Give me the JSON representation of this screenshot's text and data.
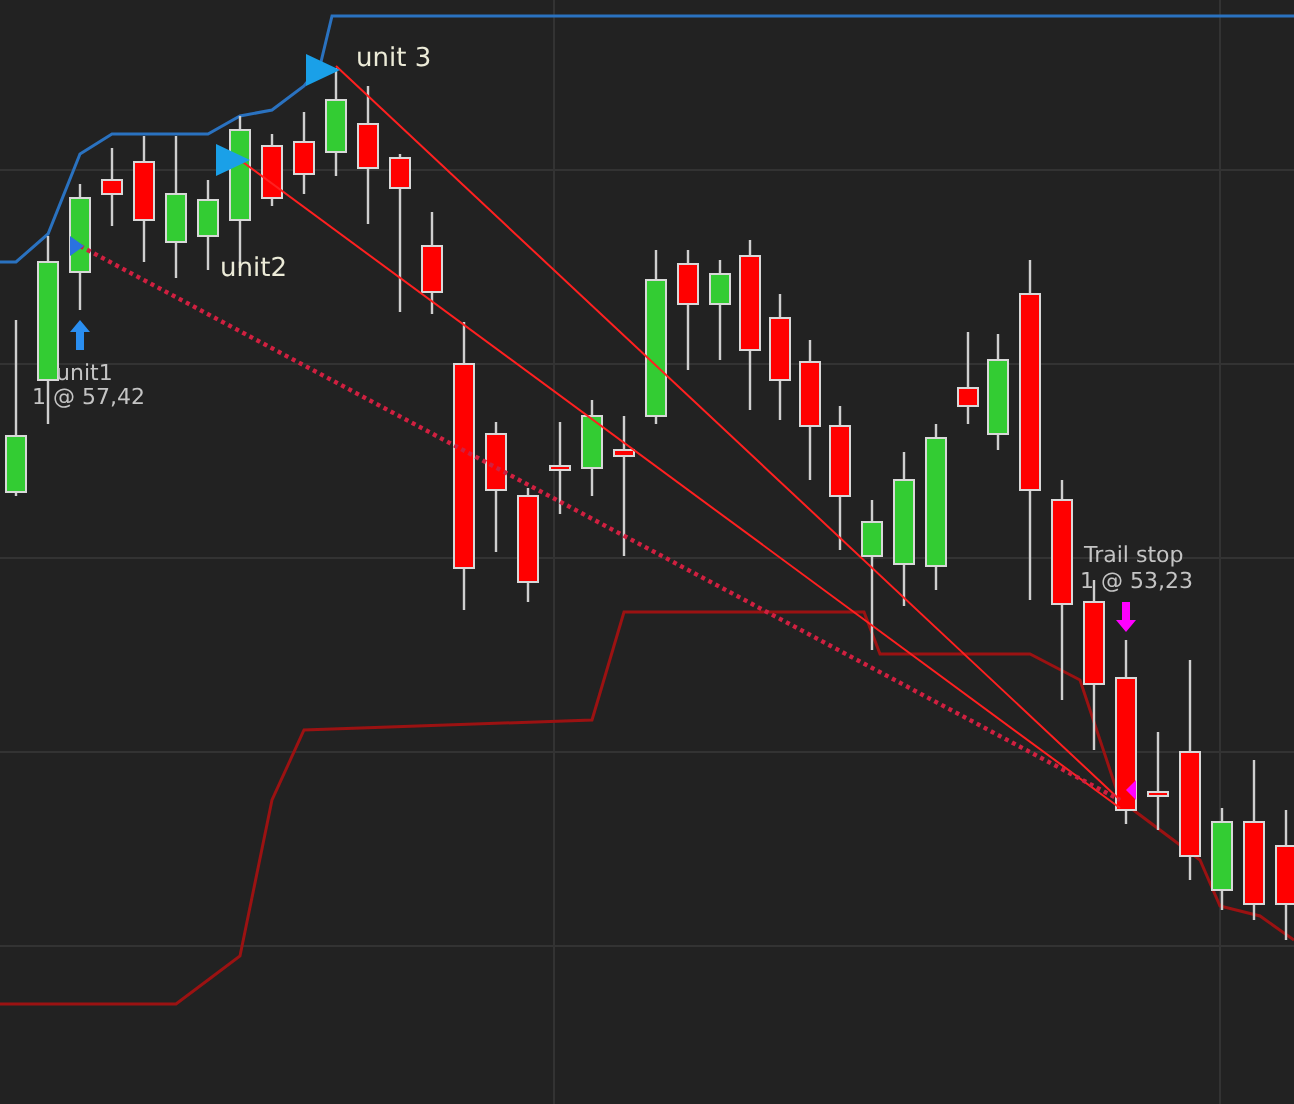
{
  "chart": {
    "annotations": [
      {
        "kind": "unit",
        "text": "unit 3"
      },
      {
        "kind": "unit",
        "text": "unit2"
      },
      {
        "kind": "fill",
        "text": "unit1"
      },
      {
        "kind": "fill",
        "text": "1 @ 57,42"
      },
      {
        "kind": "fill",
        "text": "Trail stop"
      },
      {
        "kind": "fill",
        "text": "1 @ 53,23"
      }
    ]
  }
}
